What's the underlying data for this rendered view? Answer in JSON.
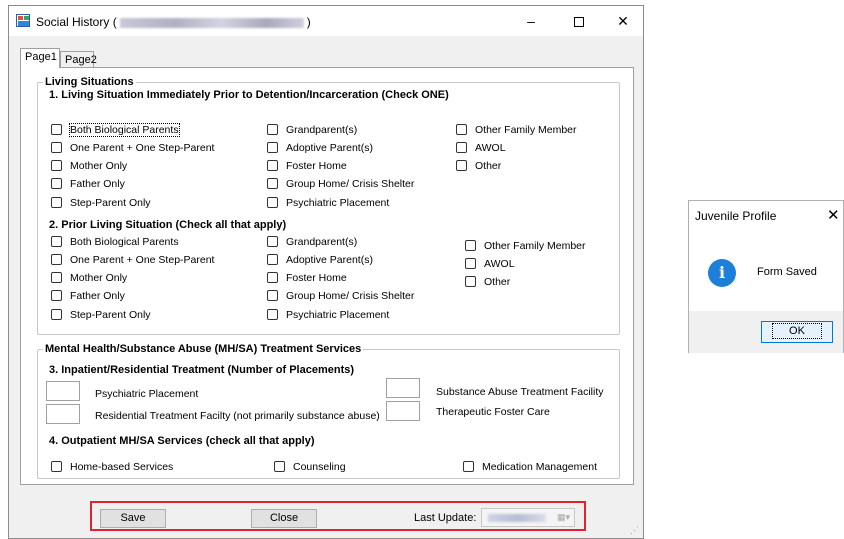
{
  "window": {
    "title_prefix": "Social History (",
    "title_suffix": ")",
    "minimize": "–",
    "close": "✕"
  },
  "tabs": [
    "Page1",
    "Page2"
  ],
  "living": {
    "legend": "Living Situations",
    "q1": "1. Living Situation Immediately Prior to Detention/Incarceration (Check ONE)",
    "q2": "2. Prior Living Situation  (Check all that apply)",
    "col1": [
      "Both Biological Parents",
      "One Parent + One Step-Parent",
      "Mother Only",
      "Father Only",
      "Step-Parent Only"
    ],
    "col2": [
      "Grandparent(s)",
      "Adoptive Parent(s)",
      "Foster Home",
      "Group Home/ Crisis Shelter",
      "Psychiatric Placement"
    ],
    "col3": [
      "Other Family Member",
      "AWOL",
      "Other"
    ]
  },
  "mhsa": {
    "legend": "Mental Health/Substance Abuse (MH/SA) Treatment Services",
    "q3": "3. Inpatient/Residential Treatment (Number of Placements)",
    "psych": "Psychiatric Placement",
    "residential": "Residential Treatment Facilty (not primarily substance abuse)",
    "substance": "Substance Abuse Treatment Facility",
    "foster": "Therapeutic Foster Care",
    "q4": "4. Outpatient MH/SA Services (check all that apply)",
    "home": "Home-based Services",
    "counseling": "Counseling",
    "medication": "Medication Management"
  },
  "footer": {
    "save": "Save",
    "close": "Close",
    "last_update": "Last Update:"
  },
  "dialog": {
    "title": "Juvenile Profile",
    "close": "✕",
    "icon": "i",
    "message": "Form Saved",
    "ok": "OK"
  }
}
